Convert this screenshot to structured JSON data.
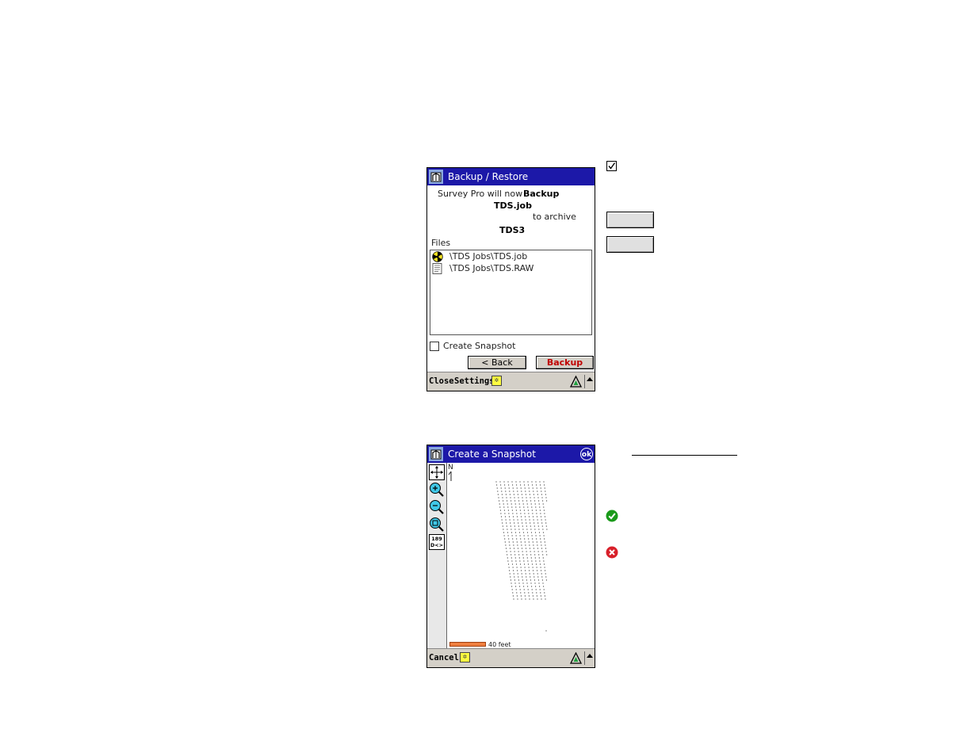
{
  "backup_screen": {
    "title": "Backup / Restore",
    "intro_line": "Survey Pro will now",
    "action": "Backup",
    "job_name": "TDS.job",
    "to_archive": "to archive",
    "archive_name": "TDS3",
    "files_label": "Files",
    "files": [
      {
        "name": "\\TDS Jobs\\TDS.job",
        "icon": "job-file-icon"
      },
      {
        "name": "\\TDS Jobs\\TDS.RAW",
        "icon": "raw-file-icon"
      }
    ],
    "create_snapshot_label": "Create Snapshot",
    "back_label": "< Back",
    "backup_label": "Backup",
    "cmd_close": "Close",
    "cmd_settings": "Settings"
  },
  "snapshot_screen": {
    "title": "Create a Snapshot",
    "ok_label": "ok",
    "north_label": "N",
    "scale_label": "40 feet",
    "cmd_cancel": "Cancel",
    "tools": [
      "zoom-extents-icon",
      "zoom-in-icon",
      "zoom-out-icon",
      "zoom-window-icon",
      "point-labels-icon"
    ]
  },
  "colors": {
    "title_bar": "#1c18a8",
    "command_bar": "#d4d0c8",
    "backup_text": "#c00000",
    "scale_bar": "#f08040",
    "check_green": "#1a9a1a",
    "cross_red": "#d8202a"
  }
}
